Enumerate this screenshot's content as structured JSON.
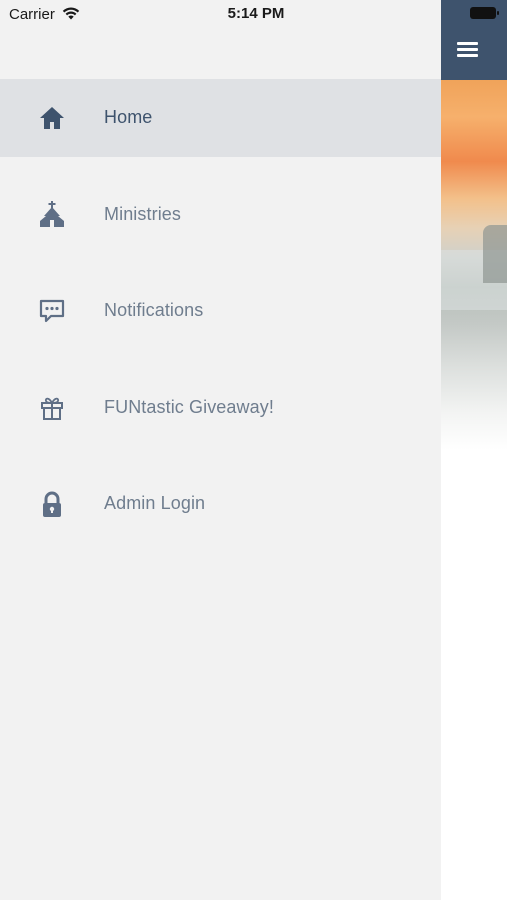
{
  "status_bar": {
    "carrier": "Carrier",
    "time": "5:14 PM"
  },
  "menu": {
    "items": [
      {
        "label": "Home",
        "icon": "home-icon",
        "active": true
      },
      {
        "label": "Ministries",
        "icon": "church-icon",
        "active": false
      },
      {
        "label": "Notifications",
        "icon": "chat-bubble-icon",
        "active": false
      },
      {
        "label": "FUNtastic Giveaway!",
        "icon": "gift-icon",
        "active": false
      },
      {
        "label": "Admin Login",
        "icon": "lock-icon",
        "active": false
      }
    ]
  },
  "colors": {
    "drawer_background": "#f2f2f2",
    "active_row": "#dfe1e4",
    "icon": "#5f6f86",
    "active_icon": "#3e536d",
    "label": "#6f7d8e",
    "navbar": "#3e536d"
  }
}
